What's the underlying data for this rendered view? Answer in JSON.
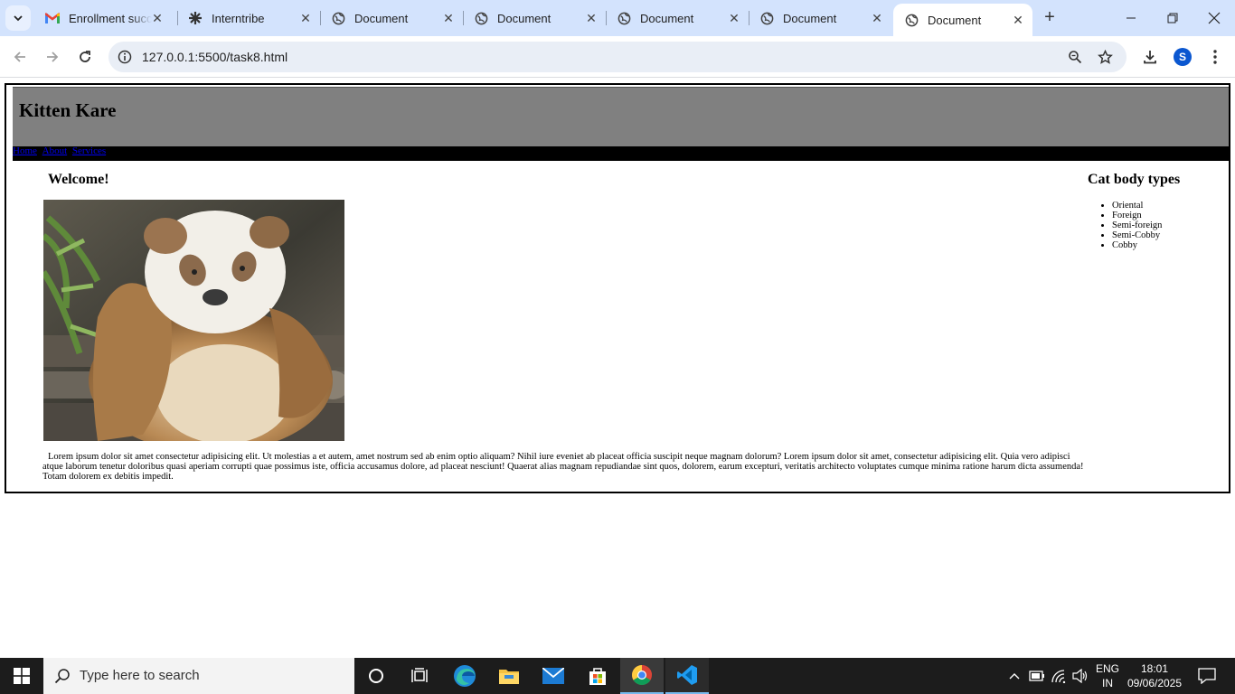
{
  "browser": {
    "tabs": [
      {
        "title": "Enrollment succe",
        "favicon": "gmail-icon",
        "active": false
      },
      {
        "title": "Interntribe",
        "favicon": "interntribe-icon",
        "active": false
      },
      {
        "title": "Document",
        "favicon": "globe-icon",
        "active": false
      },
      {
        "title": "Document",
        "favicon": "globe-icon",
        "active": false
      },
      {
        "title": "Document",
        "favicon": "globe-icon",
        "active": false
      },
      {
        "title": "Document",
        "favicon": "globe-icon",
        "active": false
      },
      {
        "title": "Document",
        "favicon": "globe-icon",
        "active": true
      }
    ],
    "close_glyph": "✕",
    "new_tab_glyph": "+",
    "address": "127.0.0.1:5500/task8.html",
    "profile_initial": "S",
    "accent": "#d3e3fd"
  },
  "page": {
    "site_title": "Kitten Kare",
    "nav": [
      "Home",
      "About",
      "Services"
    ],
    "welcome_heading": "Welcome!",
    "image_alt": "panda-photo",
    "body_text": "Lorem ipsum dolor sit amet consectetur adipisicing elit. Ut molestias a et autem, amet nostrum sed ab enim optio aliquam? Nihil iure eveniet ab placeat officia suscipit neque magnam dolorum? Lorem ipsum dolor sit amet, consectetur adipisicing elit. Quia vero adipisci atque laborum tenetur doloribus quasi aperiam corrupti quae possimus iste, officia accusamus dolore, ad placeat nesciunt! Quaerat alias magnam repudiandae sint quos, dolorem, earum excepturi, veritatis architecto voluptates cumque minima ratione harum dicta assumenda! Totam dolorem ex debitis impedit.",
    "aside_heading": "Cat body types",
    "body_types": [
      "Oriental",
      "Foreign",
      "Semi-foreign",
      "Semi-Cobby",
      "Cobby"
    ],
    "header_color": "#808080",
    "nav_color": "#000000"
  },
  "taskbar": {
    "search_placeholder": "Type here to search",
    "language": "ENG",
    "region": "IN",
    "time": "18:01",
    "date": "09/06/2025"
  }
}
